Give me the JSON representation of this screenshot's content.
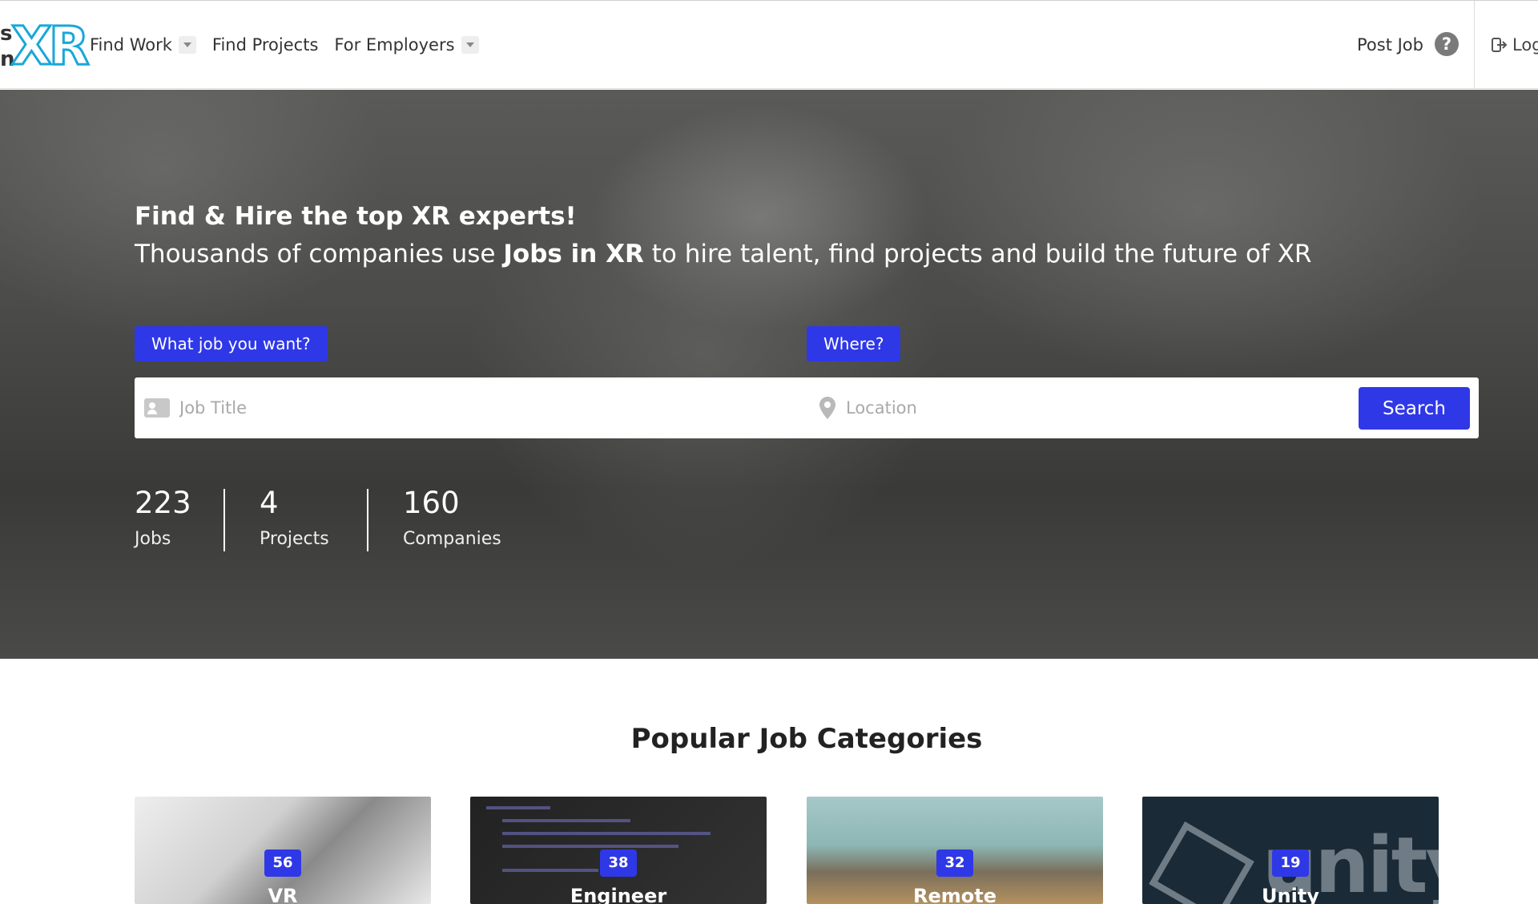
{
  "header": {
    "logo": {
      "left_text_top": "s",
      "left_text_bottom": "n",
      "mark": "XR",
      "icon": "jobs-in-xr-logo"
    },
    "nav": [
      {
        "label": "Find Work",
        "has_dropdown": true
      },
      {
        "label": "Find Projects",
        "has_dropdown": false
      },
      {
        "label": "For Employers",
        "has_dropdown": true
      }
    ],
    "post_job": "Post Job",
    "help_icon": "question-circle-icon",
    "login_label": "Log",
    "login_icon": "sign-in-icon"
  },
  "hero": {
    "line1": "Find & Hire the top XR experts!",
    "line2_before": "Thousands of companies use ",
    "line2_bold": "Jobs in XR",
    "line2_after": " to hire talent, find projects and build the future of XR",
    "what_label": "What job you want?",
    "where_label": "Where?",
    "job_placeholder": "Job Title",
    "job_value": "",
    "location_placeholder": "Location",
    "location_value": "",
    "search_button": "Search",
    "stats": [
      {
        "value": "223",
        "label": "Jobs"
      },
      {
        "value": "4",
        "label": "Projects"
      },
      {
        "value": "160",
        "label": "Companies"
      }
    ]
  },
  "categories": {
    "title": "Popular Job Categories",
    "items": [
      {
        "count": "56",
        "label": "VR"
      },
      {
        "count": "38",
        "label": "Engineer"
      },
      {
        "count": "32",
        "label": "Remote"
      },
      {
        "count": "19",
        "label": "Unity"
      }
    ]
  },
  "colors": {
    "accent": "#2f38e6",
    "logo": "#19a7d9"
  }
}
